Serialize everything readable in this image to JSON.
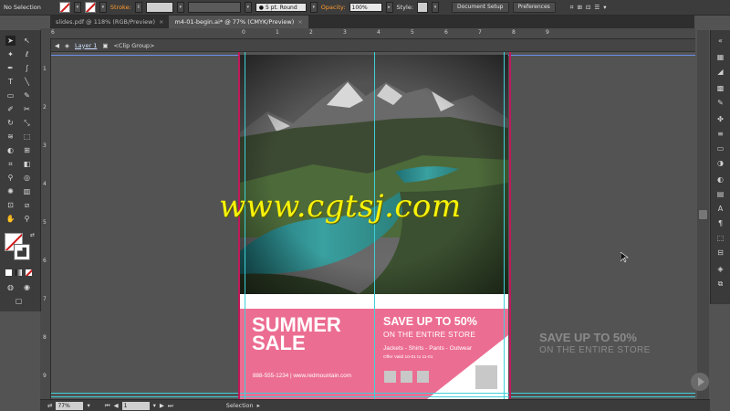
{
  "control_bar": {
    "selection_label": "No Selection",
    "stroke_label": "Stroke:",
    "brush_label": "5 pt. Round",
    "opacity_label": "Opacity:",
    "opacity_value": "100%",
    "style_label": "Style:",
    "document_setup": "Document Setup",
    "preferences": "Preferences"
  },
  "tabs": [
    {
      "label": "slides.pdf @ 118% (RGB/Preview)",
      "close": "×"
    },
    {
      "label": "m4-01-begin.ai* @ 77% (CMYK/Preview)",
      "close": "×"
    }
  ],
  "breadcrumb": {
    "layer": "Layer 1",
    "group": "<Clip Group>"
  },
  "ruler_h": [
    "6",
    "0",
    "1",
    "2",
    "3",
    "4",
    "5",
    "6",
    "7",
    "8",
    "9"
  ],
  "ruler_v": [
    "1",
    "2",
    "3",
    "4",
    "5",
    "6",
    "7",
    "8",
    "9"
  ],
  "poster": {
    "headline_line1": "SUMMER",
    "headline_line2": "SALE",
    "save_text": "SAVE UP TO 50%",
    "store_text": "ON THE ENTIRE STORE",
    "categories": "Jackets - Shirts - Pants - Outwear",
    "offer": "Offer Valid 10-01 to 11-01",
    "contact": "888-555-1234  |  www.redmountain.com"
  },
  "pasteboard_text": {
    "save": "SAVE UP TO 50%",
    "store": "ON THE ENTIRE STORE"
  },
  "status_bar": {
    "zoom": "77%",
    "page": "1",
    "tool": "Selection"
  },
  "watermark": "www.cgtsj.com",
  "colors": {
    "poster_pink": "#ec6d92",
    "guide": "#3ed0d8",
    "highlight": "#f7f20a"
  }
}
